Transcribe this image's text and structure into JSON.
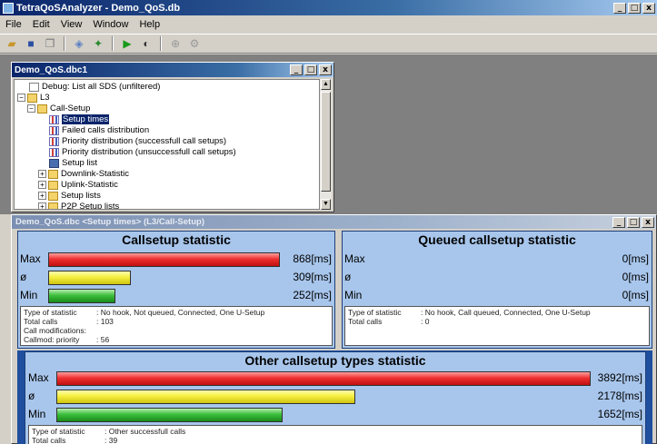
{
  "window": {
    "title": "TetraQoSAnalyzer - Demo_QoS.db"
  },
  "menu": [
    "File",
    "Edit",
    "View",
    "Window",
    "Help"
  ],
  "tree_window": {
    "title": "Demo_QoS.dbc1",
    "nodes": [
      {
        "label": "Debug: List all SDS (unfiltered)",
        "icon": "doc-icon"
      },
      {
        "label": "L3",
        "icon": "folder-icon"
      },
      {
        "label": "Call-Setup",
        "icon": "folder-icon"
      },
      {
        "label": "Setup times",
        "icon": "chart-icon",
        "selected": true
      },
      {
        "label": "Failed calls distribution",
        "icon": "chart-icon"
      },
      {
        "label": "Priority distribution (successfull call setups)",
        "icon": "chart-icon"
      },
      {
        "label": "Priority distribution (unsuccessfull call setups)",
        "icon": "chart-icon"
      },
      {
        "label": "Setup list",
        "icon": "list-icon"
      },
      {
        "label": "Downlink-Statistic",
        "icon": "folder-icon"
      },
      {
        "label": "Uplink-Statistic",
        "icon": "folder-icon"
      },
      {
        "label": "Setup lists",
        "icon": "folder-icon"
      },
      {
        "label": "P2P Setup lists",
        "icon": "folder-icon"
      }
    ]
  },
  "stat_window": {
    "title": "Demo_QoS.dbc <Setup times> (L3/Call-Setup)",
    "panels": {
      "callsetup": {
        "title": "Callsetup statistic",
        "rows": [
          {
            "label": "Max",
            "value": "868[ms]",
            "fraction": 1.0,
            "color": "red"
          },
          {
            "label": "ø",
            "value": "309[ms]",
            "fraction": 0.356,
            "color": "yellow"
          },
          {
            "label": "Min",
            "value": "252[ms]",
            "fraction": 0.29,
            "color": "green"
          }
        ],
        "info": [
          {
            "key": "Type of statistic",
            "value": ": No hook, Not queued, Connected, One U-Setup"
          },
          {
            "key": "Total calls",
            "value": ": 103"
          },
          {
            "key": "Call modifications:",
            "value": ""
          },
          {
            "key": "Callmod: priority",
            "value": ": 56"
          }
        ]
      },
      "queued": {
        "title": "Queued callsetup statistic",
        "rows": [
          {
            "label": "Max",
            "value": "0[ms]"
          },
          {
            "label": "ø",
            "value": "0[ms]"
          },
          {
            "label": "Min",
            "value": "0[ms]"
          }
        ],
        "info": [
          {
            "key": "Type of statistic",
            "value": ": No hook, Call queued, Connected, One U-Setup"
          },
          {
            "key": "Total calls",
            "value": ": 0"
          }
        ]
      },
      "other": {
        "title": "Other callsetup types statistic",
        "rows": [
          {
            "label": "Max",
            "value": "3892[ms]",
            "fraction": 1.0,
            "color": "red"
          },
          {
            "label": "ø",
            "value": "2178[ms]",
            "fraction": 0.56,
            "color": "yellow"
          },
          {
            "label": "Min",
            "value": "1652[ms]",
            "fraction": 0.424,
            "color": "green"
          }
        ],
        "info": [
          {
            "key": "Type of statistic",
            "value": ": Other successfull calls"
          },
          {
            "key": "Total calls",
            "value": ": 39"
          }
        ]
      }
    }
  }
}
